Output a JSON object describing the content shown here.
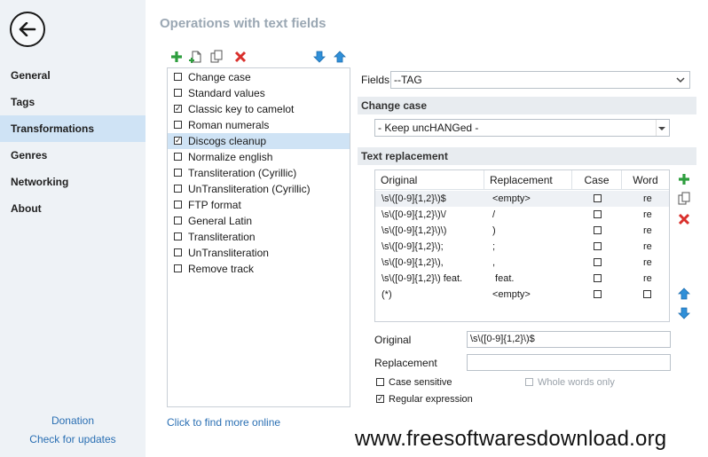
{
  "sidebar": {
    "items": [
      {
        "label": "General",
        "active": false
      },
      {
        "label": "Tags",
        "active": false
      },
      {
        "label": "Transformations",
        "active": true
      },
      {
        "label": "Genres",
        "active": false
      },
      {
        "label": "Networking",
        "active": false
      },
      {
        "label": "About",
        "active": false
      }
    ],
    "donation_label": "Donation",
    "updates_label": "Check for updates"
  },
  "page_title": "Operations with text fields",
  "toolbar_icons": [
    "add-icon",
    "new-document-icon",
    "copy-icon",
    "delete-icon",
    "move-down-icon",
    "move-up-icon"
  ],
  "transformations": [
    {
      "label": "Change case",
      "checked": false,
      "selected": false
    },
    {
      "label": "Standard values",
      "checked": false,
      "selected": false
    },
    {
      "label": "Classic key to camelot",
      "checked": true,
      "selected": false
    },
    {
      "label": "Roman numerals",
      "checked": false,
      "selected": false
    },
    {
      "label": "Discogs cleanup",
      "checked": true,
      "selected": true
    },
    {
      "label": "Normalize english",
      "checked": false,
      "selected": false
    },
    {
      "label": "Transliteration (Cyrillic)",
      "checked": false,
      "selected": false
    },
    {
      "label": "UnTransliteration (Cyrillic)",
      "checked": false,
      "selected": false
    },
    {
      "label": "FTP format",
      "checked": false,
      "selected": false
    },
    {
      "label": "General Latin",
      "checked": false,
      "selected": false
    },
    {
      "label": "Transliteration",
      "checked": false,
      "selected": false
    },
    {
      "label": "UnTransliteration",
      "checked": false,
      "selected": false
    },
    {
      "label": "Remove track",
      "checked": false,
      "selected": false
    }
  ],
  "find_online_label": "Click to find more online",
  "fields": {
    "label": "Fields",
    "value": "--TAG"
  },
  "change_case": {
    "heading": "Change case",
    "value": "- Keep uncHANGed -"
  },
  "text_replacement": {
    "heading": "Text replacement",
    "columns": [
      "Original",
      "Replacement",
      "Case",
      "Word"
    ],
    "rows": [
      {
        "original": "\\s\\([0-9]{1,2}\\)$",
        "replacement": "<empty>",
        "case": false,
        "word": "re"
      },
      {
        "original": "\\s\\([0-9]{1,2}\\)\\/",
        "replacement": "/",
        "case": false,
        "word": "re"
      },
      {
        "original": "\\s\\([0-9]{1,2}\\)\\)",
        "replacement": ")",
        "case": false,
        "word": "re"
      },
      {
        "original": "\\s\\([0-9]{1,2}\\);",
        "replacement": ";",
        "case": false,
        "word": "re"
      },
      {
        "original": "\\s\\([0-9]{1,2}\\),",
        "replacement": ",",
        "case": false,
        "word": "re"
      },
      {
        "original": "\\s\\([0-9]{1,2}\\) feat.",
        "replacement": " feat.",
        "case": false,
        "word": "re"
      },
      {
        "original": "(*)",
        "replacement": "<empty>",
        "case": false,
        "word": ""
      }
    ],
    "side_icons": [
      "add-icon",
      "copy-icon",
      "delete-icon",
      "move-up-icon",
      "move-down-icon"
    ]
  },
  "editor": {
    "original_label": "Original",
    "original_value": "\\s\\([0-9]{1,2}\\)$",
    "replacement_label": "Replacement",
    "replacement_value": "",
    "case_sensitive_label": "Case sensitive",
    "case_sensitive": false,
    "whole_words_label": "Whole words only",
    "whole_words": false,
    "regex_label": "Regular expression",
    "regex": true
  },
  "watermark": "www.freesoftwaresdownload.org",
  "colors": {
    "accent": "#2a6fb3",
    "selection": "#cfe3f5",
    "add_green": "#2e9e3e",
    "delete_red": "#d9302c",
    "arrow_blue": "#2f8fd8"
  }
}
